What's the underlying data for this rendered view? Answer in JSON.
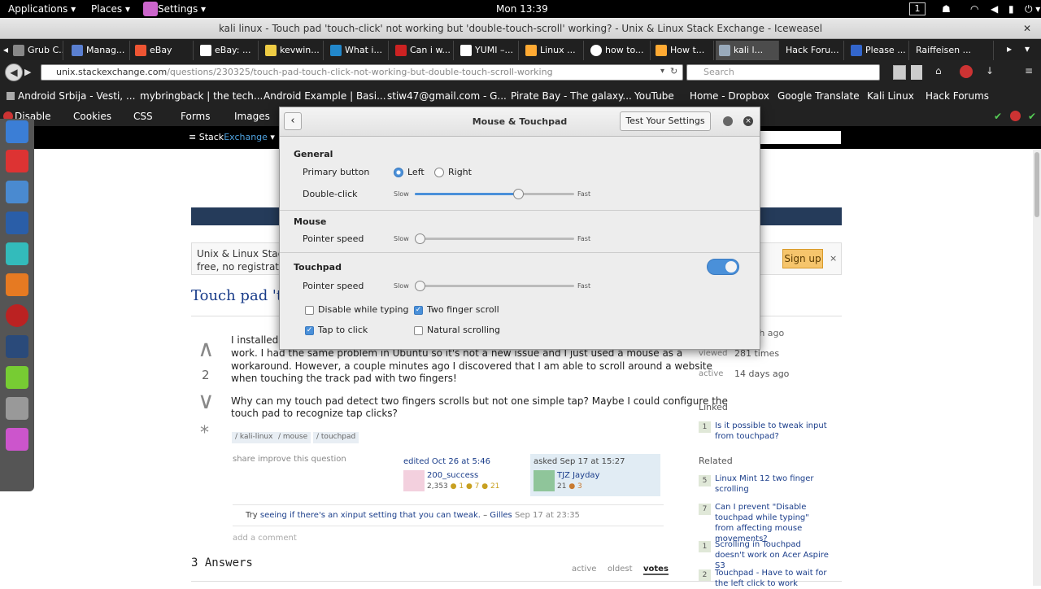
{
  "topbar": {
    "applications": "Applications",
    "places": "Places",
    "settings": "Settings",
    "clock": "Mon 13:39",
    "workspace": "1"
  },
  "window_title": "kali linux - Touch pad 'touch-click' not working but 'double-touch-scroll' working? - Unix & Linux Stack Exchange - Iceweasel",
  "tabs": [
    "Grub C...",
    "Manag...",
    "eBay",
    "eBay: ...",
    "kevwin...",
    "What i...",
    "Can i w...",
    "YUMI –...",
    "Linux ...",
    "how to...",
    "How t...",
    "kali l...",
    "Hack Foru...",
    "Please ...",
    "Raiffeisen ..."
  ],
  "url": {
    "host": "unix.stackexchange.com",
    "path": "/questions/230325/touch-pad-touch-click-not-working-but-double-touch-scroll-working"
  },
  "search_placeholder": "Search",
  "bookmarks": [
    "Android Srbija - Vesti, ...",
    "mybringback | the tech...",
    "Android Example | Basi...",
    "stiw47@gmail.com - G...",
    "Pirate Bay - The galaxy...",
    "YouTube",
    "Home - Dropbox",
    "Google Translate",
    "Kali Linux",
    "Hack Forums"
  ],
  "devbar": [
    "Disable",
    "Cookies",
    "CSS",
    "Forms",
    "Images"
  ],
  "se_logo": {
    "a": "Stack",
    "b": "Exchange"
  },
  "banner": {
    "line1": "Unix & Linux Stack",
    "line2": "free, no registration",
    "signup": "Sign up",
    "close": "×"
  },
  "question": {
    "title": "Touch pad 'tou",
    "votes": "2",
    "p1a": "I installed K",
    "p1b": "work. I had the same problem in Ubuntu so it's not a new issue and I just used a mouse as a",
    "p1c": "workaround. However, a couple minutes ago I discovered that I am able to scroll around a website",
    "p1d": "when touching the track pad with two fingers!",
    "p2a": "Why can my touch pad detect two fingers scrolls but not one simple tap? Maybe I could configure the",
    "p2b": "touch pad to recognize tap clicks?",
    "tags": [
      "kali-linux",
      "mouse",
      "touchpad"
    ],
    "share": "share",
    "improve": "improve this question",
    "edited": "edited Oct 26 at 5:46",
    "editor": "200_success",
    "editor_rep": "2,353",
    "editor_badges": "● 1 ● 7 ● 21",
    "asked": "asked Sep 17 at 15:27",
    "asker": "TJZ Jayday",
    "asker_rep": "21",
    "asker_badges": "● 3",
    "comment_prefix": "Try ",
    "comment_link": "seeing if there's an xinput setting that you can tweak.",
    "comment_sep": " – ",
    "comment_user": "Gilles",
    "comment_time": "Sep 17 at 23:35",
    "add_comment": "add a comment",
    "answers": "3 Answers",
    "sort": [
      "active",
      "oldest",
      "votes"
    ]
  },
  "sidebar": {
    "asked_val": "th ago",
    "viewed_label": "viewed",
    "viewed_val": "281 times",
    "active_label": "active",
    "active_val": "14 days ago",
    "linked_title": "Linked",
    "linked": [
      {
        "count": "1",
        "text": "Is it possible to tweak input from touchpad?"
      }
    ],
    "related_title": "Related",
    "related": [
      {
        "count": "5",
        "text": "Linux Mint 12 two finger scrolling"
      },
      {
        "count": "7",
        "text": "Can I prevent \"Disable touchpad while typing\" from affecting mouse movements?"
      },
      {
        "count": "1",
        "text": "Scrolling in Touchpad doesn't work on Acer Aspire S3"
      },
      {
        "count": "2",
        "text": "Touchpad - Have to wait for the left click to work"
      }
    ]
  },
  "dialog": {
    "title": "Mouse & Touchpad",
    "test_button": "Test Your Settings",
    "general": "General",
    "primary_button": "Primary button",
    "left": "Left",
    "right": "Right",
    "double_click": "Double-click",
    "slow": "Slow",
    "fast": "Fast",
    "double_click_level": 0.65,
    "mouse": "Mouse",
    "pointer_speed": "Pointer speed",
    "mouse_speed_level": 0.03,
    "touchpad": "Touchpad",
    "touchpad_enabled": true,
    "touchpad_speed_level": 0.03,
    "disable_typing": "Disable while typing",
    "two_finger": "Two finger scroll",
    "tap_click": "Tap to click",
    "natural": "Natural scrolling"
  }
}
